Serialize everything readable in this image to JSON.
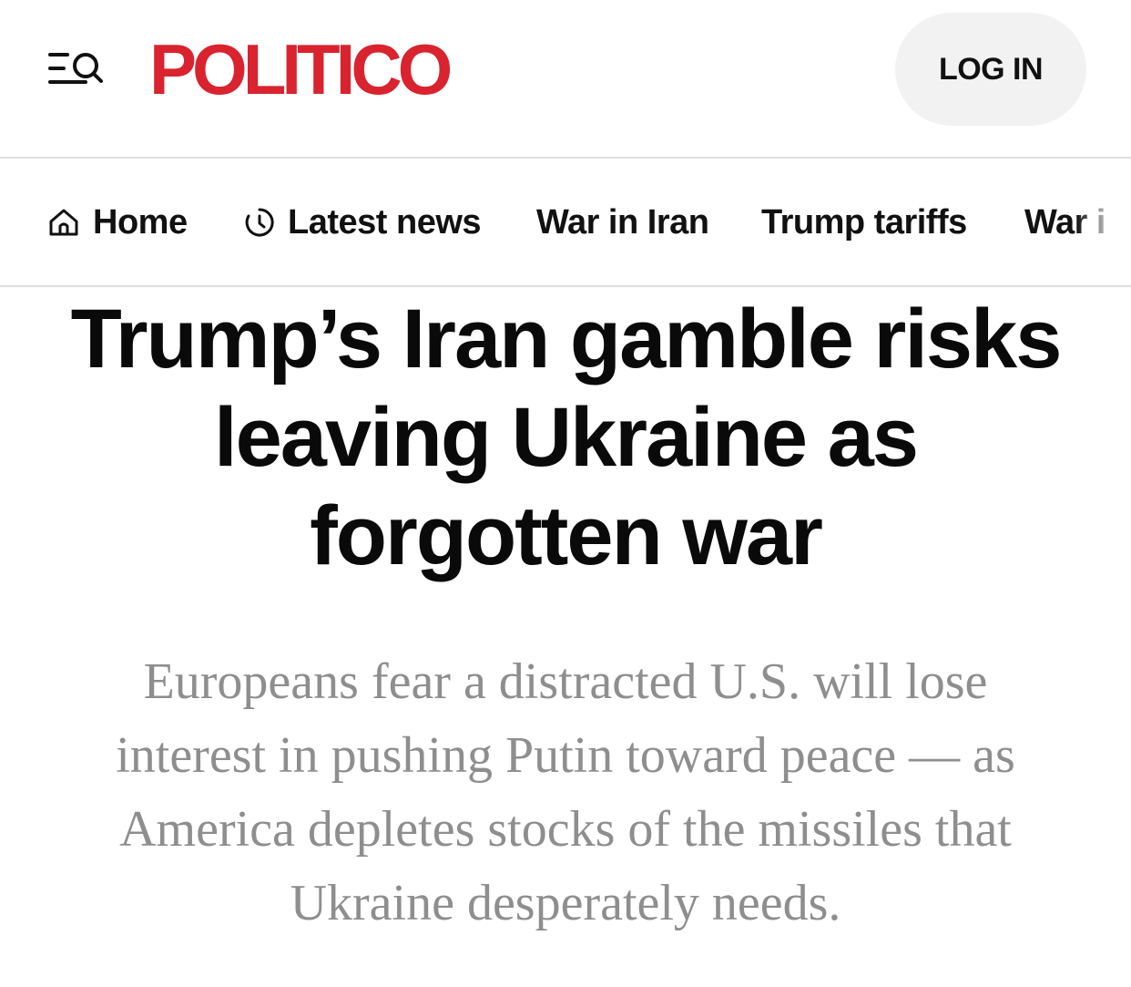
{
  "header": {
    "logo_text": "POLITICO",
    "login_label": "LOG IN"
  },
  "nav": {
    "items": [
      {
        "label": "Home",
        "icon": "home-icon"
      },
      {
        "label": "Latest news",
        "icon": "clock-icon"
      },
      {
        "label": "War in Iran"
      },
      {
        "label": "Trump tariffs"
      },
      {
        "label": "War i"
      }
    ]
  },
  "article": {
    "headline": "Trump’s Iran gamble risks leaving Ukraine as forgotten war",
    "dek": "Europeans fear a distracted U.S. will lose interest in pushing Putin toward peace — as America depletes stocks of the missiles that Ukraine desperately needs."
  },
  "colors": {
    "brand": "#d9232f",
    "dek_text": "#8e8e8e",
    "login_bg": "#f2f2f2",
    "divider": "#dedede"
  }
}
